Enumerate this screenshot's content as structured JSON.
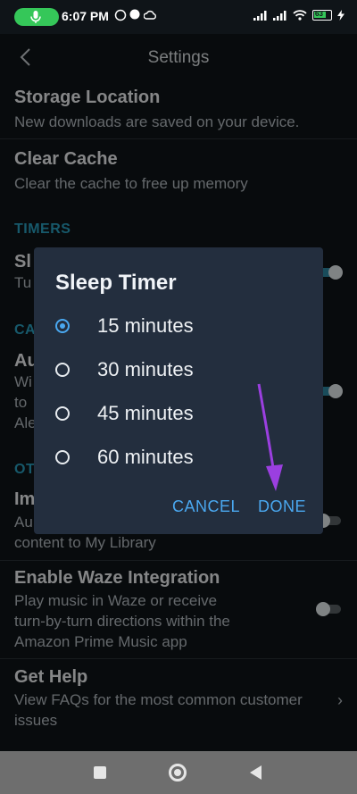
{
  "status": {
    "time": "6:07 PM",
    "battery": "63"
  },
  "header": {
    "title": "Settings",
    "back_icon": "back-arrow-icon"
  },
  "settings": {
    "storage": {
      "title": "Storage Location",
      "subtitle": "New downloads are saved on your device."
    },
    "cache": {
      "title": "Clear Cache",
      "subtitle": "Clear the cache to free up memory"
    },
    "timers_section": "TIMERS",
    "sleep_partial": {
      "title": "Sl",
      "subtitle": "Tu"
    },
    "section_ca": "CA",
    "auto_partial": {
      "title": "Au",
      "sub1": "Wi",
      "sub2": "to",
      "sub3": "Ale"
    },
    "section_ot": "OT",
    "import_partial": {
      "title": "Im",
      "sub1": "Au",
      "sub2": "content to My Library"
    },
    "waze": {
      "title": "Enable Waze Integration",
      "sub1": "Play music in Waze or receive",
      "sub2": "turn-by-turn directions within the",
      "sub3": "Amazon Prime Music app"
    },
    "help": {
      "title": "Get Help",
      "sub1": "View FAQs for the most common customer",
      "sub2": "issues"
    }
  },
  "dialog": {
    "title": "Sleep Timer",
    "options": [
      "15 minutes",
      "30 minutes",
      "45 minutes",
      "60 minutes"
    ],
    "selected_index": 0,
    "cancel": "CANCEL",
    "done": "DONE"
  },
  "colors": {
    "accent": "#4aa8f0",
    "section": "#2aa3c4",
    "dialog_bg": "#232e3e",
    "arrow": "#9b3fe0"
  }
}
